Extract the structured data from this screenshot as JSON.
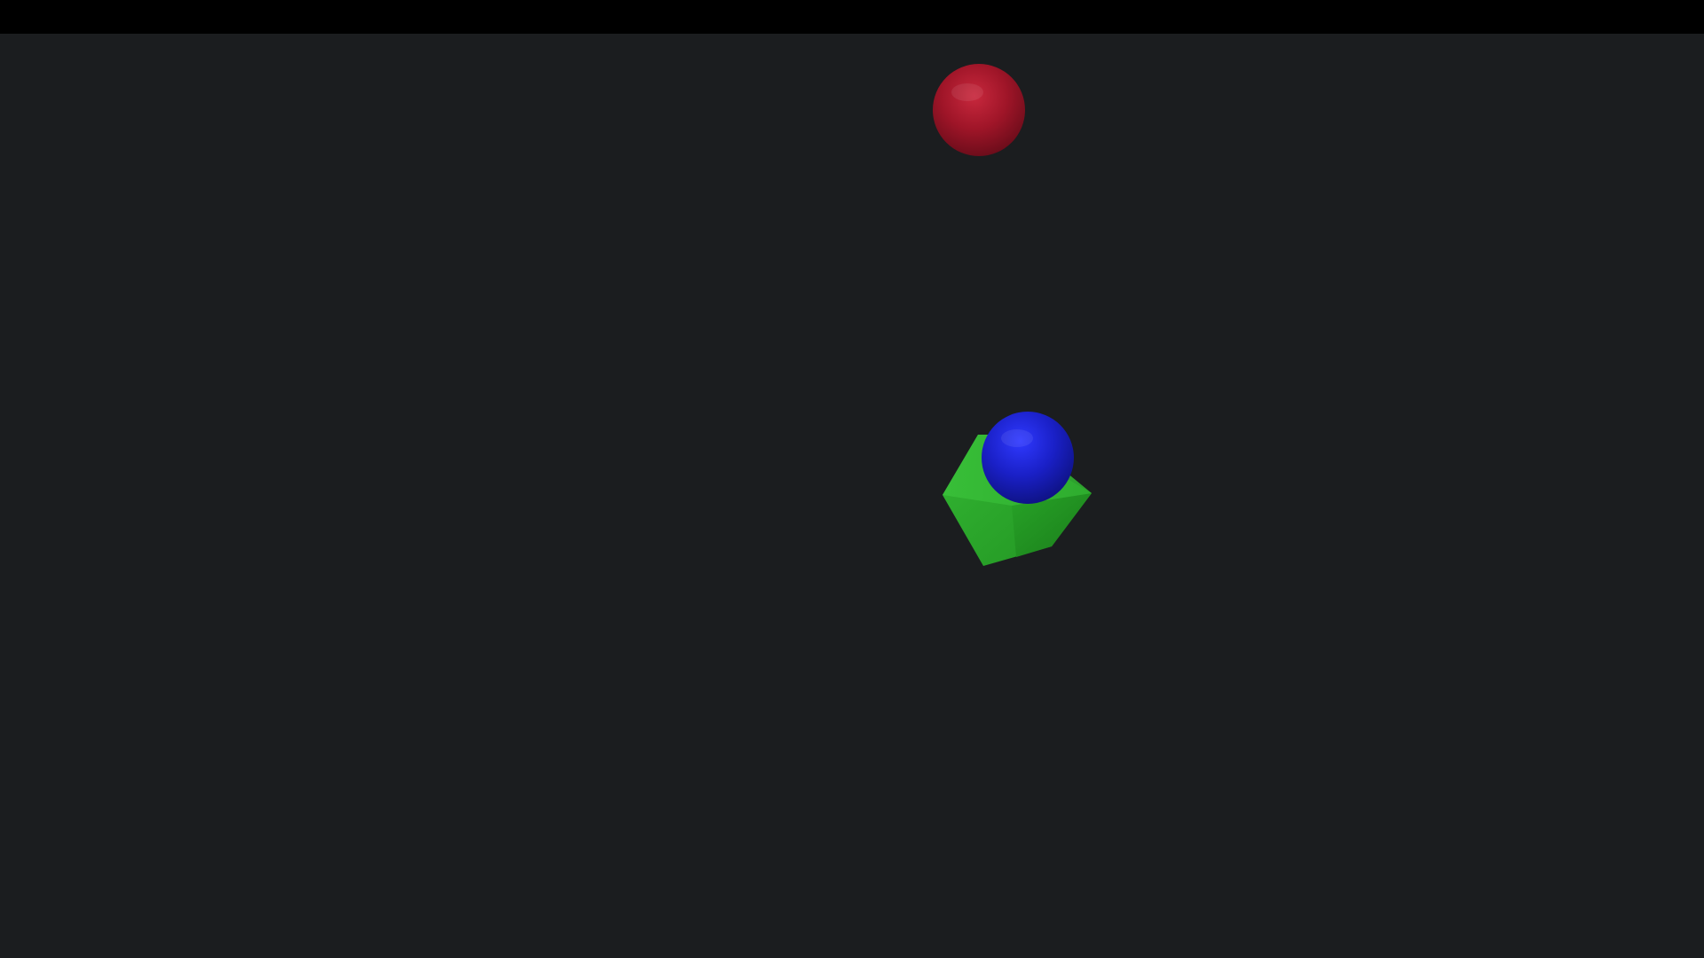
{
  "window": {
    "title": ""
  },
  "viewport": {
    "background_color": "#1b1d1f",
    "top_bar_color": "#000000"
  },
  "scene": {
    "objects": [
      {
        "id": "red-sphere",
        "shape": "sphere",
        "color": "#a8162a"
      },
      {
        "id": "green-cube",
        "shape": "cube",
        "color": "#2aa52a"
      },
      {
        "id": "blue-sphere",
        "shape": "sphere",
        "color": "#1c22c8"
      }
    ]
  }
}
